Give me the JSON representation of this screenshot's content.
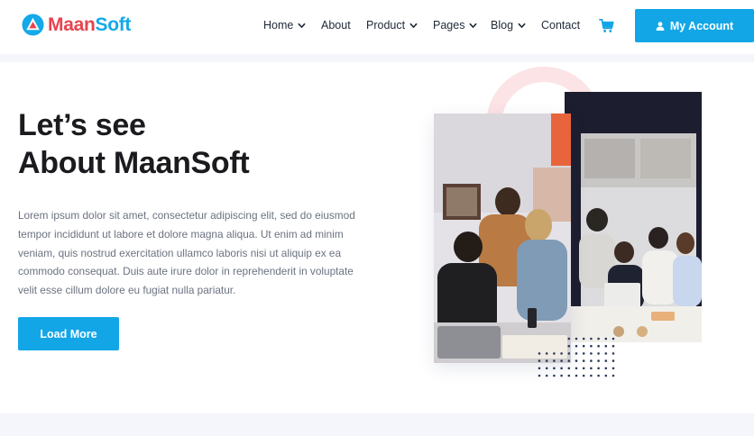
{
  "brand": {
    "name_part1": "Maan",
    "name_part2": "Soft"
  },
  "nav": {
    "items": [
      {
        "label": "Home",
        "has_dropdown": true
      },
      {
        "label": "About",
        "has_dropdown": false
      },
      {
        "label": "Product",
        "has_dropdown": true
      },
      {
        "label": "Pages",
        "has_dropdown": true
      },
      {
        "label": "Blog",
        "has_dropdown": true
      },
      {
        "label": "Contact",
        "has_dropdown": false
      }
    ],
    "cart_icon": "cart-icon",
    "account_button": {
      "label": "My Account",
      "icon": "user-icon"
    }
  },
  "hero": {
    "title_line1": "Let’s see",
    "title_line2": "About MaanSoft",
    "body_lines": [
      "Lorem ipsum dolor sit amet, consectetur adipiscing elit, sed do eiusmod",
      "tempor incididunt ut labore et dolore magna aliqua. Ut enim ad minim",
      "veniam, quis nostrud exercitation ullamco laboris nisi ut aliquip ex ea",
      "commodo consequat. Duis aute irure dolor in reprehenderit in voluptate",
      "velit esse cillum dolore eu fugiat nulla pariatur."
    ],
    "cta_label": "Load More"
  },
  "colors": {
    "accent": "#12a6e6",
    "brand_red": "#e8434f",
    "brand_blue": "#13a9e8",
    "heading": "#1b1b1f",
    "body_text": "#6b7280",
    "band": "#f5f6fb",
    "ring": "#fbe3e6"
  }
}
